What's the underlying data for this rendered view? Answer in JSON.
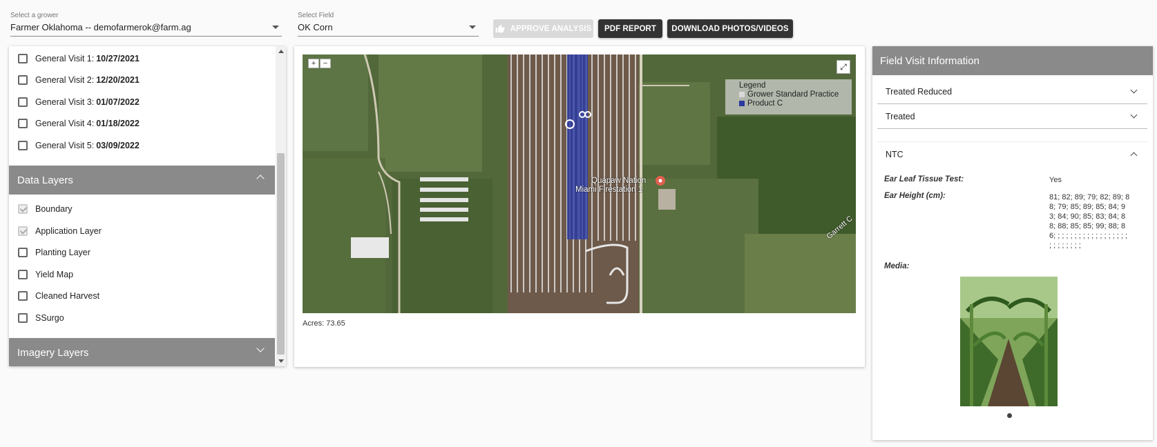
{
  "grower": {
    "label": "Select a grower",
    "value": "Farmer Oklahoma -- demofarmerok@farm.ag"
  },
  "field": {
    "label": "Select Field",
    "value": "OK Corn"
  },
  "toolbar": {
    "approve_label": "APPROVE ANALYSIS",
    "pdf_label": "PDF REPORT",
    "download_label": "DOWNLOAD PHOTOS/VIDEOS"
  },
  "visits": [
    {
      "name": "General Visit 1:",
      "date": "10/27/2021"
    },
    {
      "name": "General Visit 2:",
      "date": "12/20/2021"
    },
    {
      "name": "General Visit 3:",
      "date": "01/07/2022"
    },
    {
      "name": "General Visit 4:",
      "date": "01/18/2022"
    },
    {
      "name": "General Visit 5:",
      "date": "03/09/2022"
    }
  ],
  "data_layers": {
    "title": "Data Layers",
    "items": [
      {
        "label": "Boundary",
        "checked": true
      },
      {
        "label": "Application Layer",
        "checked": true
      },
      {
        "label": "Planting Layer",
        "checked": false
      },
      {
        "label": "Yield Map",
        "checked": false
      },
      {
        "label": "Cleaned Harvest",
        "checked": false
      },
      {
        "label": "SSurgo",
        "checked": false
      }
    ]
  },
  "imagery_layers": {
    "title": "Imagery Layers"
  },
  "map": {
    "zoom_in": "+",
    "zoom_out": "−",
    "fullscreen": "⤢",
    "legend_title": "Legend",
    "legend_items": [
      {
        "label": "Grower Standard Practice",
        "color": "#d9d9d9"
      },
      {
        "label": "Product C",
        "color": "#2b3a9e"
      }
    ],
    "place_label_1": "Quapaw Nation",
    "place_label_2": "Miami Firestation 1",
    "road_label": "Garrett C",
    "acres": "Acres: 73.65"
  },
  "field_visit": {
    "title": "Field Visit Information",
    "sections": [
      "Treated Reduced",
      "Treated",
      "NTC"
    ],
    "ear_leaf_label": "Ear Leaf Tissue Test:",
    "ear_leaf_value": "Yes",
    "ear_height_label": "Ear Height (cm):",
    "ear_height_value": "81; 82; 89; 79; 82; 89; 88; 79; 85; 89; 85; 84; 93; 84; 90; 85; 83; 84; 88; 88; 85; 85; 99; 88; 86; ; ; ; ; ; ; ; ; ; ; ; ; ; ; ; ; ; ; ; ; ; ; ; ; ;",
    "media_label": "Media:"
  }
}
